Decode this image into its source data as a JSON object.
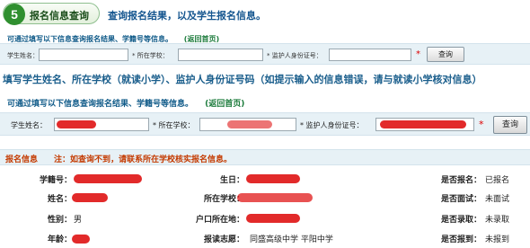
{
  "header": {
    "step_number": "5",
    "step_title": "报名信息查询",
    "description": "查询报名结果，以及学生报名信息。"
  },
  "form1": {
    "hint": "可通过填写以下信息查询报名结果、学籍号等信息。",
    "back_link": "(返回首页)",
    "student_name_label": "学生姓名：",
    "school_label": "* 所在学校：",
    "guardian_id_label": "* 监护人身份证号：",
    "required_mark": "*",
    "query_button": "查询"
  },
  "instruction": "填写学生姓名、所在学校（就读小学）、监护人身份证号码（如提示输入的信息错误，请与就读小学核对信息）",
  "form2": {
    "hint": "可通过填写以下信息查询报名结果、学籍号等信息。",
    "back_link": "(返回首页)",
    "student_name_label": "学生姓名：",
    "school_label": "* 所在学校：",
    "guardian_id_label": "* 监护人身份证号：",
    "required_mark": "*",
    "query_button": "查询"
  },
  "info": {
    "title": "报名信息",
    "note": "注：如查询不到，请联系所在学校核实报名信息。",
    "fields": {
      "student_no_label": "学籍号：",
      "birthday_label": "生日：",
      "registered_label": "是否报名：",
      "registered_value": "已报名",
      "name_label": "姓名：",
      "school_label": "所在学校：",
      "interviewed_label": "是否面试：",
      "interviewed_value": "未面试",
      "gender_label": "性别：",
      "gender_value": "男",
      "household_label": "户口所在地：",
      "admitted_label": "是否录取：",
      "admitted_value": "未录取",
      "age_label": "年龄：",
      "choice_label": "报读志愿：",
      "choice_value": "同盛高级中学  平阳中学",
      "reported_label": "是否报到：",
      "reported_value": "未报到"
    }
  },
  "colors": {
    "accent_green": "#2f8f2f",
    "title_blue": "#14558f",
    "info_orange": "#c43a00",
    "redaction_red": "#e01818",
    "row_bg": "#e7f1f6"
  }
}
